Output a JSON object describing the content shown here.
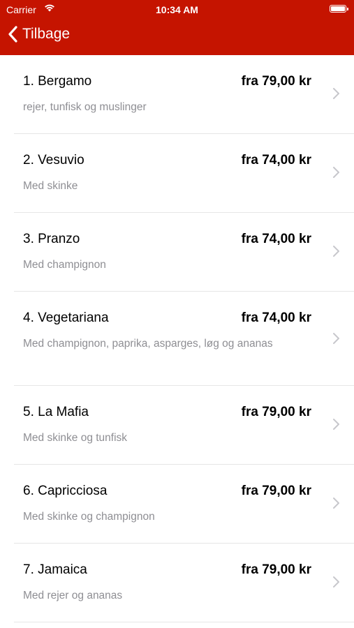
{
  "status_bar": {
    "carrier": "Carrier",
    "time": "10:34 AM"
  },
  "nav": {
    "back_label": "Tilbage"
  },
  "colors": {
    "header_background": "#c51400",
    "description_text": "#8e8e93"
  },
  "menu": [
    {
      "name": "1. Bergamo",
      "price": "fra 79,00 kr",
      "description": "rejer, tunfisk og muslinger"
    },
    {
      "name": "2. Vesuvio",
      "price": "fra 74,00 kr",
      "description": "Med  skinke"
    },
    {
      "name": "3. Pranzo",
      "price": "fra 74,00 kr",
      "description": "Med  champignon"
    },
    {
      "name": "4. Vegetariana",
      "price": "fra 74,00 kr",
      "description": "Med  champignon, paprika, asparges, løg og ananas"
    },
    {
      "name": "5. La Mafia",
      "price": "fra 79,00 kr",
      "description": "Med skinke og tunfisk"
    },
    {
      "name": "6. Capricciosa",
      "price": "fra 79,00 kr",
      "description": "Med skinke og champignon"
    },
    {
      "name": "7. Jamaica",
      "price": "fra 79,00 kr",
      "description": "Med rejer og ananas"
    }
  ]
}
